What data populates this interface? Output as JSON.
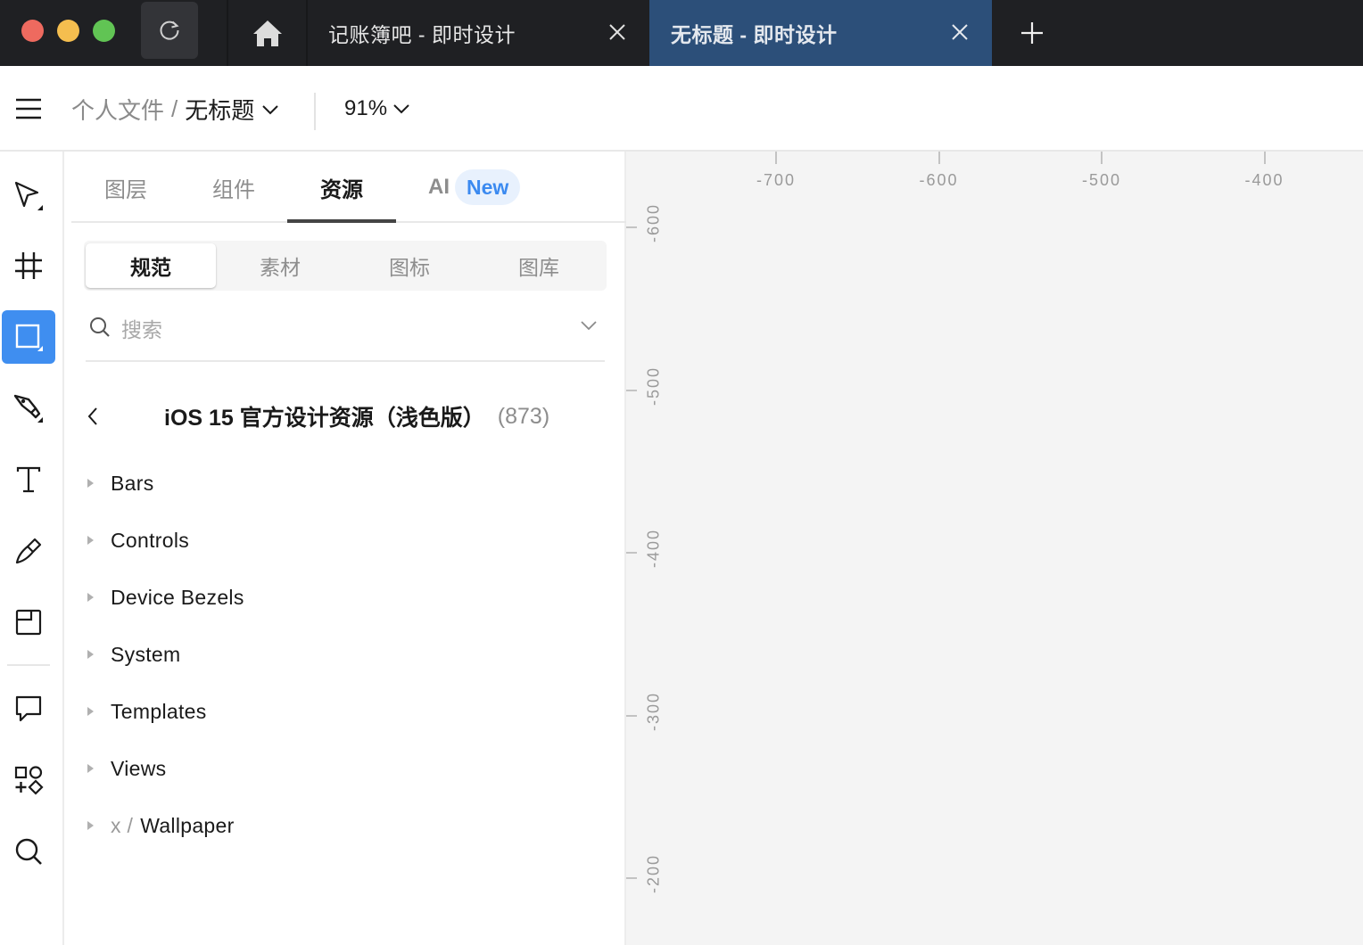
{
  "titlebar": {
    "window_controls": [
      "close",
      "minimize",
      "maximize"
    ],
    "reload_icon": "reload-icon",
    "home_icon": "home-icon",
    "tabs": [
      {
        "title": "记账簿吧 - 即时设计",
        "active": false
      },
      {
        "title": "无标题 - 即时设计",
        "active": true
      }
    ],
    "new_tab_icon": "plus-icon"
  },
  "toolbar": {
    "menu_icon": "hamburger-menu-icon",
    "breadcrumb": {
      "parent": "个人文件",
      "separator": "/",
      "current": "无标题"
    },
    "zoom_level": "91%"
  },
  "tools": [
    {
      "name": "move",
      "icon": "cursor-arrow-icon",
      "active": false
    },
    {
      "name": "frame",
      "icon": "frame-hash-icon",
      "active": false
    },
    {
      "name": "rectangle",
      "icon": "rectangle-icon",
      "active": true
    },
    {
      "name": "pen",
      "icon": "pen-nib-icon",
      "active": false
    },
    {
      "name": "text",
      "icon": "text-icon",
      "active": false
    },
    {
      "name": "pencil",
      "icon": "pencil-icon",
      "active": false
    },
    {
      "name": "slice",
      "icon": "section-icon",
      "active": false
    },
    {
      "name": "comment",
      "icon": "comment-icon",
      "active": false
    },
    {
      "name": "plugins",
      "icon": "shapes-plugin-icon",
      "active": false
    },
    {
      "name": "search",
      "icon": "search-icon",
      "active": false
    }
  ],
  "panel": {
    "tabs": [
      {
        "label": "图层",
        "active": false
      },
      {
        "label": "组件",
        "active": false
      },
      {
        "label": "资源",
        "active": true
      },
      {
        "label": "AI",
        "badge": "New",
        "active": false
      }
    ],
    "segments": [
      {
        "label": "规范",
        "active": true
      },
      {
        "label": "素材",
        "active": false
      },
      {
        "label": "图标",
        "active": false
      },
      {
        "label": "图库",
        "active": false
      }
    ],
    "search": {
      "placeholder": "搜索",
      "value": ""
    },
    "library": {
      "title": "iOS 15 官方设计资源（浅色版）",
      "count": "(873)"
    },
    "tree": [
      {
        "prefix": "",
        "label": "Bars"
      },
      {
        "prefix": "",
        "label": "Controls"
      },
      {
        "prefix": "",
        "label": "Device Bezels"
      },
      {
        "prefix": "",
        "label": "System"
      },
      {
        "prefix": "",
        "label": "Templates"
      },
      {
        "prefix": "",
        "label": "Views"
      },
      {
        "prefix": "x /",
        "label": "Wallpaper"
      }
    ]
  },
  "canvas": {
    "ruler_horizontal": [
      "-700",
      "-600",
      "-500",
      "-400"
    ],
    "ruler_vertical": [
      "-600",
      "-500",
      "-400",
      "-300",
      "-200"
    ]
  },
  "colors": {
    "titlebar_bg": "#1f2023",
    "active_tab_bg": "#2c4f79",
    "accent": "#3f8ef0",
    "badge_bg": "#e8f1fd",
    "badge_text": "#3b8af0",
    "canvas_bg": "#f4f4f4"
  }
}
